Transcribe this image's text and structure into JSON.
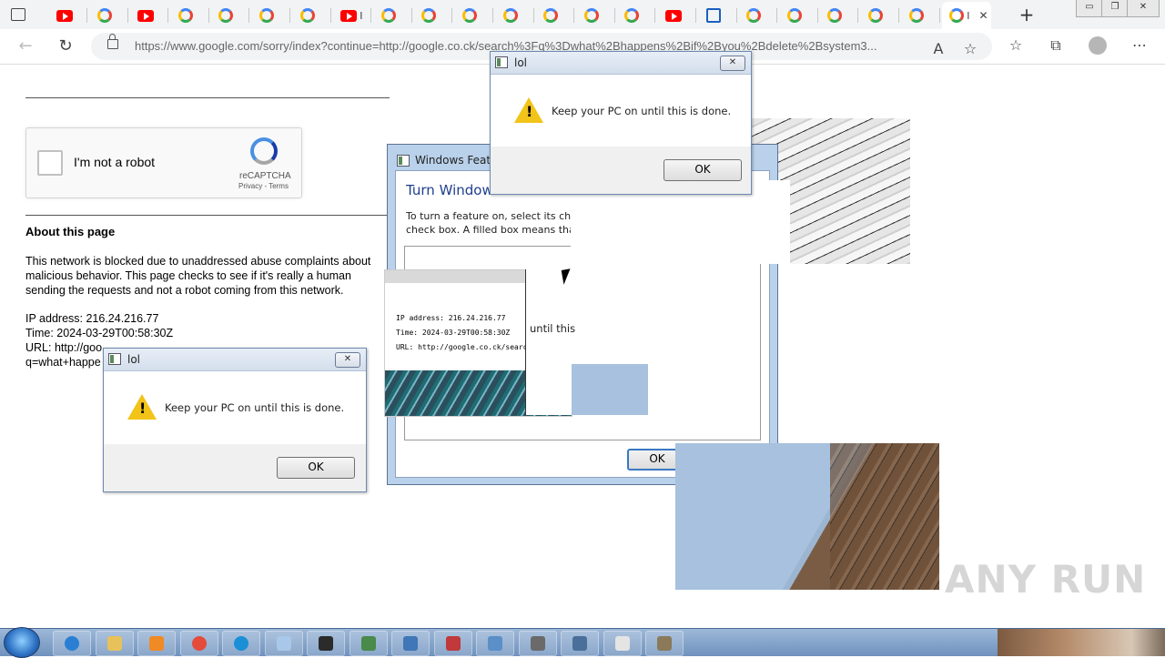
{
  "browser": {
    "tabs": [
      {
        "kind": "youtube",
        "label": ""
      },
      {
        "kind": "google",
        "label": ""
      },
      {
        "kind": "youtube",
        "label": ""
      },
      {
        "kind": "google",
        "label": ""
      },
      {
        "kind": "google",
        "label": ""
      },
      {
        "kind": "google",
        "label": ""
      },
      {
        "kind": "google",
        "label": ""
      },
      {
        "kind": "youtube",
        "label": "I"
      },
      {
        "kind": "google",
        "label": ""
      },
      {
        "kind": "google",
        "label": ""
      },
      {
        "kind": "google",
        "label": ""
      },
      {
        "kind": "google",
        "label": ""
      },
      {
        "kind": "google",
        "label": ""
      },
      {
        "kind": "google",
        "label": ""
      },
      {
        "kind": "google",
        "label": ""
      },
      {
        "kind": "youtube",
        "label": ""
      },
      {
        "kind": "ms",
        "label": ""
      },
      {
        "kind": "google",
        "label": ""
      },
      {
        "kind": "google",
        "label": ""
      },
      {
        "kind": "google",
        "label": ""
      },
      {
        "kind": "google",
        "label": ""
      },
      {
        "kind": "google",
        "label": ""
      },
      {
        "kind": "active",
        "label": "I"
      }
    ],
    "active_tab_close": "✕",
    "new_tab": "+",
    "window_controls": [
      "▭",
      "❐",
      "✕"
    ],
    "url": "https://www.google.com/sorry/index?continue=http://google.co.ck/search%3Fq%3Dwhat%2Bhappens%2Bif%2Byou%2Bdelete%2Bsystem3...",
    "nav": {
      "back": "←",
      "refresh": "↻"
    },
    "tools": {
      "read_aloud": "A",
      "favorite_add": "☆",
      "favorites": "☆",
      "collections": "⧉",
      "menu": "⋯"
    }
  },
  "page": {
    "recaptcha": {
      "label": "I'm not a robot",
      "brand": "reCAPTCHA",
      "links": "Privacy - Terms"
    },
    "about_title": "About this page",
    "about_text": "This network is blocked due to unaddressed abuse complaints about malicious behavior. This page checks to see if it's really a human sending the requests and not a robot coming from this network.",
    "ip_line": "IP address: 216.24.216.77",
    "time_line": "Time: 2024-03-29T00:58:30Z",
    "url_line1": "URL: http://goo",
    "url_line2": "q=what+happe"
  },
  "dialogs": {
    "lol_top": {
      "title": "lol",
      "message": "Keep your PC on until this is done.",
      "ok": "OK",
      "close": "✕"
    },
    "lol_left": {
      "title": "lol",
      "message": "Keep your PC on until this is done.",
      "ok": "OK",
      "close": "✕"
    },
    "windows_features": {
      "title": "Windows Featu",
      "heading": "Turn Window",
      "desc_line1": "To turn a feature on, select its check box. To turn a",
      "desc_line2": "check box. A filled box means that only part of the",
      "ok": "OK"
    }
  },
  "glitch": {
    "fragment_text": "until this",
    "thumb_lines": [
      "IP address: 216.24.216.77",
      "Time: 2024-03-29T00:58:30Z",
      "URL: http://google.co.ck/search?"
    ]
  },
  "watermark": "ANY RUN",
  "taskbar": {
    "items": [
      "ie",
      "explorer",
      "media",
      "chrome",
      "edge",
      "notepad",
      "cmd",
      "tool",
      "tool2",
      "remote",
      "network",
      "notepad2",
      "calc",
      "doc",
      "tool3"
    ]
  }
}
